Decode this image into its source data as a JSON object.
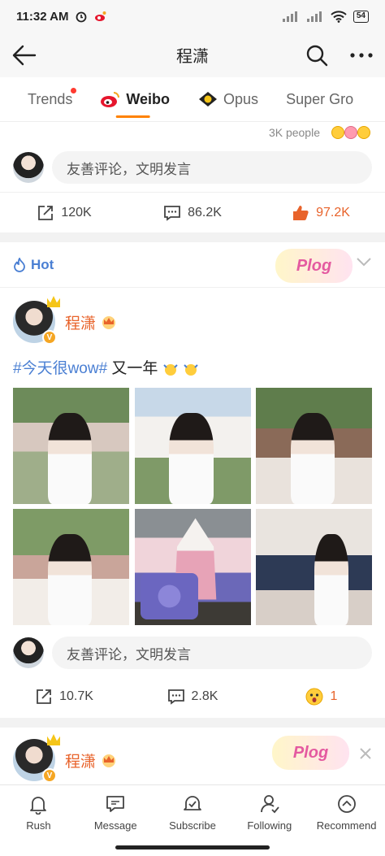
{
  "status_bar": {
    "time": "11:32 AM",
    "battery": "54"
  },
  "header": {
    "title": "程潇"
  },
  "tabs": [
    {
      "label": "Trends",
      "has_dot": true
    },
    {
      "label": "Weibo",
      "active": true
    },
    {
      "label": "Opus"
    },
    {
      "label": "Super Gro"
    }
  ],
  "prev_post": {
    "reaction_text": "3K people",
    "comment_placeholder": "友善评论，文明发言",
    "shares": "120K",
    "comments": "86.2K",
    "likes": "97.2K"
  },
  "hot_section": {
    "label": "Hot",
    "sticker_text": "Plog"
  },
  "post": {
    "author": "程潇",
    "hashtag": "#今天很wow#",
    "text": " 又一年",
    "comment_placeholder": "友善评论，文明发言",
    "shares": "10.7K",
    "comments": "2.8K",
    "likes": "1"
  },
  "next_post": {
    "author": "程潇",
    "sticker_text": "Plog"
  },
  "bottom_nav": [
    {
      "label": "Rush",
      "icon": "bell-icon"
    },
    {
      "label": "Message",
      "icon": "message-icon"
    },
    {
      "label": "Subscribe",
      "icon": "subscribe-icon"
    },
    {
      "label": "Following",
      "icon": "following-icon"
    },
    {
      "label": "Recommend",
      "icon": "recommend-icon"
    }
  ],
  "colors": {
    "accent": "#ff8200",
    "link": "#4a7fd3",
    "like": "#e8632b"
  }
}
